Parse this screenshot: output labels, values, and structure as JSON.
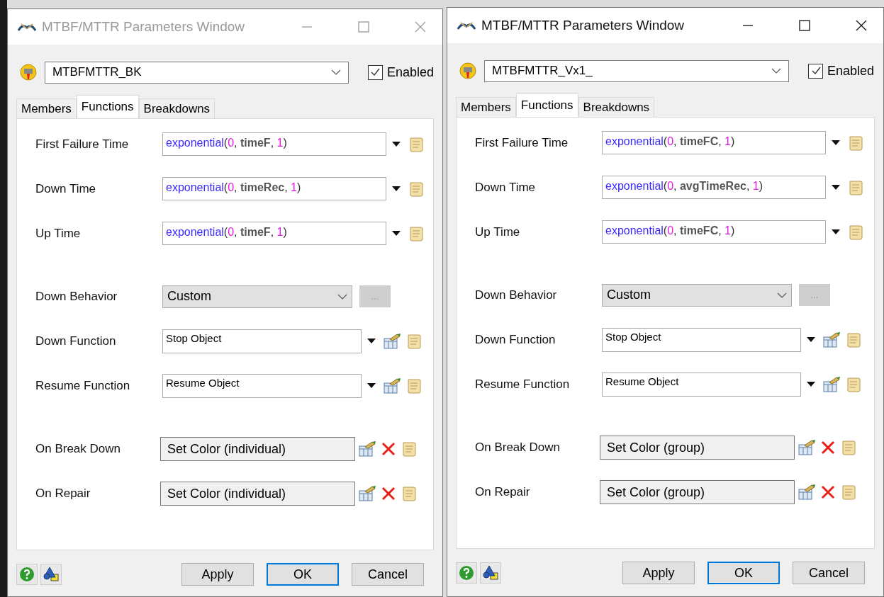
{
  "windows": [
    {
      "title": "MTBF/MTTR Parameters Window",
      "active": false,
      "object": "MTBFMTTR_BK",
      "enabled": {
        "label": "Enabled",
        "checked": true
      },
      "tabs": [
        {
          "label": "Members",
          "selected": false
        },
        {
          "label": "Functions",
          "selected": true
        },
        {
          "label": "Breakdowns",
          "selected": false
        }
      ],
      "sections": [
        [
          {
            "kind": "expression",
            "label": "First Failure Time",
            "parts": [
              {
                "text": "exponential",
                "kind": "function"
              },
              {
                "text": "(",
                "kind": "punct"
              },
              {
                "text": "0",
                "kind": "number"
              },
              {
                "text": ", ",
                "kind": "punct"
              },
              {
                "text": "timeF",
                "kind": "name"
              },
              {
                "text": ", ",
                "kind": "punct"
              },
              {
                "text": "1",
                "kind": "number"
              },
              {
                "text": ")",
                "kind": "punct"
              }
            ]
          },
          {
            "kind": "expression",
            "label": "Down Time",
            "parts": [
              {
                "text": "exponential",
                "kind": "function"
              },
              {
                "text": "(",
                "kind": "punct"
              },
              {
                "text": "0",
                "kind": "number"
              },
              {
                "text": ", ",
                "kind": "punct"
              },
              {
                "text": "timeRec",
                "kind": "name"
              },
              {
                "text": ", ",
                "kind": "punct"
              },
              {
                "text": "1",
                "kind": "number"
              },
              {
                "text": ")",
                "kind": "punct"
              }
            ]
          },
          {
            "kind": "expression",
            "label": "Up Time",
            "parts": [
              {
                "text": "exponential",
                "kind": "function"
              },
              {
                "text": "(",
                "kind": "punct"
              },
              {
                "text": "0",
                "kind": "number"
              },
              {
                "text": ", ",
                "kind": "punct"
              },
              {
                "text": "timeF",
                "kind": "name"
              },
              {
                "text": ", ",
                "kind": "punct"
              },
              {
                "text": "1",
                "kind": "number"
              },
              {
                "text": ")",
                "kind": "punct"
              }
            ]
          }
        ],
        [
          {
            "kind": "dropdown",
            "label": "Down Behavior",
            "value": "Custom",
            "button": {
              "label": "...",
              "disabled": true
            }
          },
          {
            "kind": "picklist",
            "label": "Down Function",
            "value": "Stop Object"
          },
          {
            "kind": "picklist",
            "label": "Resume Function",
            "value": "Resume Object"
          }
        ],
        [
          {
            "kind": "trigger",
            "label": "On Break Down",
            "value": "Set Color (individual)"
          },
          {
            "kind": "trigger",
            "label": "On Repair",
            "value": "Set Color (individual)"
          }
        ]
      ],
      "buttons": [
        {
          "label": "Apply",
          "default": false
        },
        {
          "label": "OK",
          "default": true
        },
        {
          "label": "Cancel",
          "default": false
        }
      ]
    },
    {
      "title": "MTBF/MTTR Parameters Window",
      "active": true,
      "object": "MTBFMTTR_Vx1_",
      "enabled": {
        "label": "Enabled",
        "checked": true
      },
      "tabs": [
        {
          "label": "Members",
          "selected": false
        },
        {
          "label": "Functions",
          "selected": true
        },
        {
          "label": "Breakdowns",
          "selected": false
        }
      ],
      "sections": [
        [
          {
            "kind": "expression",
            "label": "First Failure Time",
            "parts": [
              {
                "text": "exponential",
                "kind": "function"
              },
              {
                "text": "(",
                "kind": "punct"
              },
              {
                "text": "0",
                "kind": "number"
              },
              {
                "text": ", ",
                "kind": "punct"
              },
              {
                "text": "timeFC",
                "kind": "name"
              },
              {
                "text": ", ",
                "kind": "punct"
              },
              {
                "text": "1",
                "kind": "number"
              },
              {
                "text": ")",
                "kind": "punct"
              }
            ]
          },
          {
            "kind": "expression",
            "label": "Down Time",
            "parts": [
              {
                "text": "exponential",
                "kind": "function"
              },
              {
                "text": "(",
                "kind": "punct"
              },
              {
                "text": "0",
                "kind": "number"
              },
              {
                "text": ", ",
                "kind": "punct"
              },
              {
                "text": "avgTimeRec",
                "kind": "name"
              },
              {
                "text": ", ",
                "kind": "punct"
              },
              {
                "text": "1",
                "kind": "number"
              },
              {
                "text": ")",
                "kind": "punct"
              }
            ]
          },
          {
            "kind": "expression",
            "label": "Up Time",
            "parts": [
              {
                "text": "exponential",
                "kind": "function"
              },
              {
                "text": "(",
                "kind": "punct"
              },
              {
                "text": "0",
                "kind": "number"
              },
              {
                "text": ", ",
                "kind": "punct"
              },
              {
                "text": "timeFC",
                "kind": "name"
              },
              {
                "text": ", ",
                "kind": "punct"
              },
              {
                "text": "1",
                "kind": "number"
              },
              {
                "text": ")",
                "kind": "punct"
              }
            ]
          }
        ],
        [
          {
            "kind": "dropdown",
            "label": "Down Behavior",
            "value": "Custom",
            "button": {
              "label": "...",
              "disabled": true
            }
          },
          {
            "kind": "picklist",
            "label": "Down Function",
            "value": "Stop Object"
          },
          {
            "kind": "picklist",
            "label": "Resume Function",
            "value": "Resume Object"
          }
        ],
        [
          {
            "kind": "trigger",
            "label": "On Break Down",
            "value": "Set Color (group)"
          },
          {
            "kind": "trigger",
            "label": "On Repair",
            "value": "Set Color (group)"
          }
        ]
      ],
      "buttons": [
        {
          "label": "Apply",
          "default": false
        },
        {
          "label": "OK",
          "default": true
        },
        {
          "label": "Cancel",
          "default": false
        }
      ]
    }
  ]
}
